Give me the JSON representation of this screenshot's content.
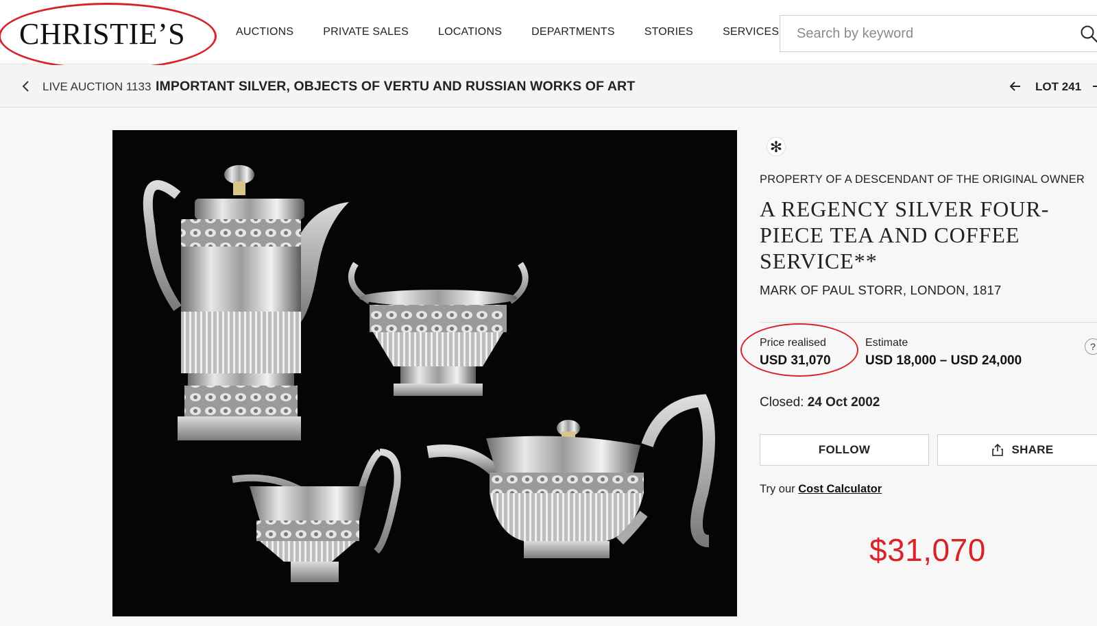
{
  "brand": {
    "logo_text": "CHRISTIE’S",
    "highlight_color": "#d8232a"
  },
  "nav": {
    "items": [
      "AUCTIONS",
      "PRIVATE SALES",
      "LOCATIONS",
      "DEPARTMENTS",
      "STORIES",
      "SERVICES"
    ]
  },
  "search": {
    "placeholder": "Search by keyword",
    "icon": "search-icon"
  },
  "breadcrumb": {
    "live_label": "LIVE AUCTION 1133",
    "sale_title": "IMPORTANT SILVER, OBJECTS OF VERTU AND RUSSIAN WORKS OF ART",
    "lot_label": "LOT 241"
  },
  "lot": {
    "badge_symbol": "✻",
    "provenance": "PROPERTY OF A DESCENDANT OF THE ORIGINAL OWNER",
    "title": "A REGENCY SILVER FOUR-PIECE TEA AND COFFEE SERVICE**",
    "maker": "MARK OF PAUL STORR, LONDON, 1817",
    "price_label": "Price realised",
    "price_value": "USD 31,070",
    "estimate_label": "Estimate",
    "estimate_value": "USD 18,000 – USD 24,000",
    "help_symbol": "?",
    "closed_label": "Closed:",
    "closed_date": "24 Oct 2002",
    "follow_label": "FOLLOW",
    "share_label": "SHARE",
    "calc_prefix": "Try our",
    "calc_link": "Cost Calculator"
  },
  "annotation": {
    "big_price": "$31,070"
  }
}
